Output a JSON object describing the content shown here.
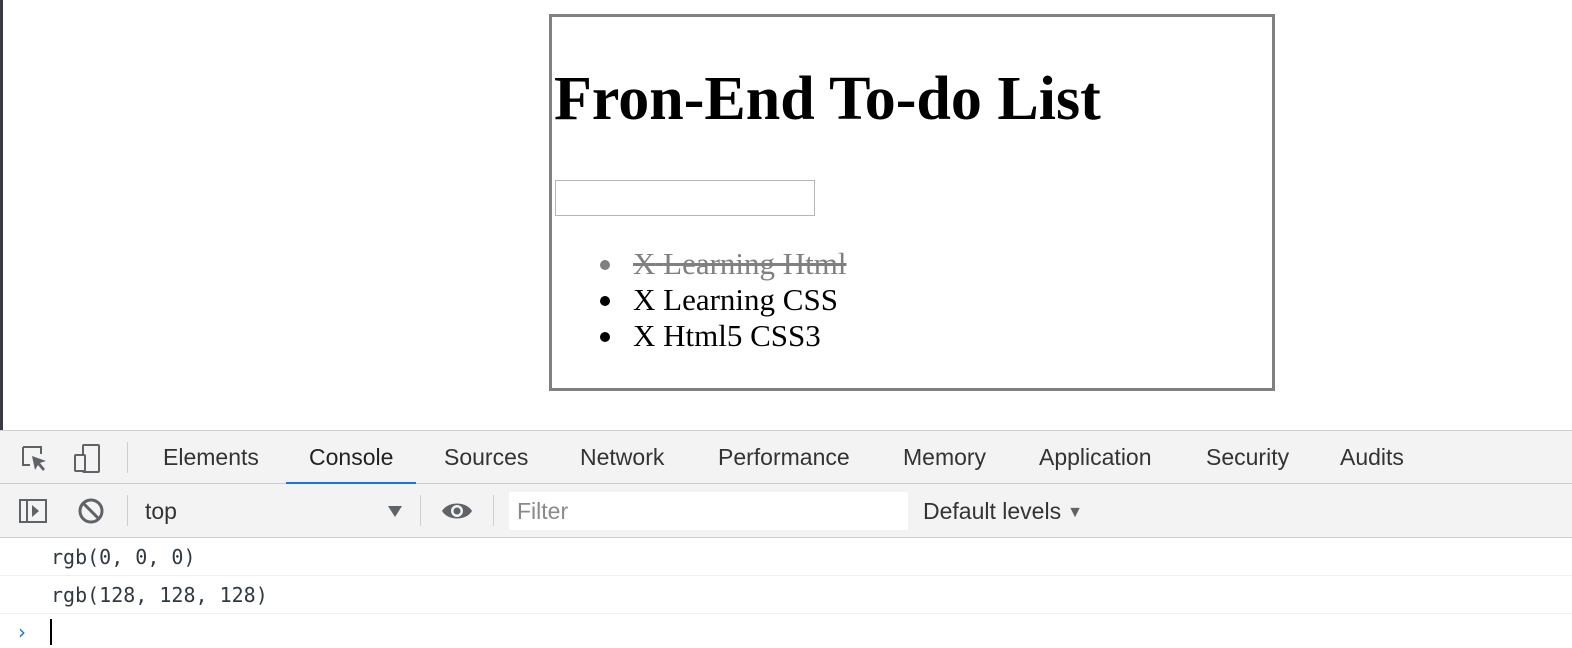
{
  "page": {
    "heading": "Fron-End To-do List",
    "input_value": "",
    "items": [
      {
        "remove": "X",
        "text": "Learning Html",
        "done": true
      },
      {
        "remove": "X",
        "text": "Learning CSS",
        "done": false
      },
      {
        "remove": "X",
        "text": "Html5 CSS3",
        "done": false
      }
    ]
  },
  "devtools": {
    "tabs": {
      "elements": "Elements",
      "console": "Console",
      "sources": "Sources",
      "network": "Network",
      "performance": "Performance",
      "memory": "Memory",
      "application": "Application",
      "security": "Security",
      "audits": "Audits"
    },
    "active_tab": "Console",
    "toolbar": {
      "context": "top",
      "filter_placeholder": "Filter",
      "levels": "Default levels",
      "levels_caret": "▼"
    },
    "console_lines": [
      "rgb(0, 0, 0)",
      "rgb(128, 128, 128)"
    ],
    "prompt_symbol": "›"
  },
  "colors": {
    "accent": "#1a73e8",
    "done_item": "#808080",
    "box_border": "#808080",
    "toolbar_bg": "#f3f3f3"
  },
  "icons": [
    "inspect-element-icon",
    "device-toolbar-icon",
    "sidebar-toggle-icon",
    "clear-console-icon",
    "eye-icon",
    "dropdown-arrow-icon",
    "prompt-chevron-icon"
  ]
}
